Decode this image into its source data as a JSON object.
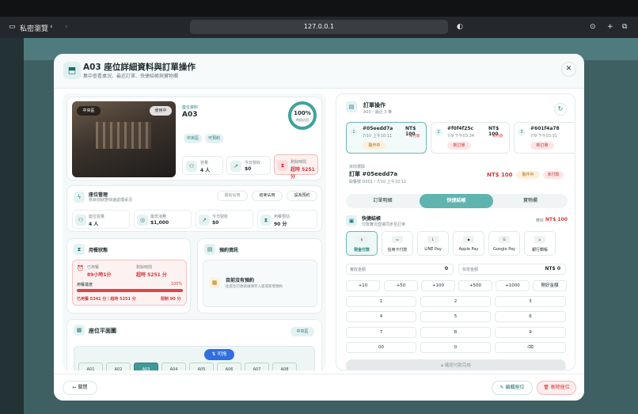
{
  "browser": {
    "private": "私密瀏覽",
    "url": "127.0.0.1"
  },
  "modal": {
    "title": "A03 座位詳細資料與訂單操作",
    "subtitle": "集中查看桌況、最近訂單、快捷結帳與寶物欄",
    "close": "✕",
    "seat_card": {
      "photo_zone": "中央區",
      "photo_status": "使用中",
      "label": "座位資料",
      "name": "A03",
      "ring_pct": "100%",
      "ring_label": "時段佔用",
      "ring_value": 1.0,
      "tags": [
        "中央區",
        "可預約"
      ],
      "stats": [
        {
          "label": "容量",
          "value": "4 人"
        },
        {
          "label": "今日營收",
          "value": "$0"
        },
        {
          "label": "剩餘時間",
          "value": "超時 5251 分"
        }
      ]
    },
    "management": {
      "title": "座位管理",
      "sub": "依目前狀態快速處理桌況",
      "btns": [
        "開始佔用",
        "結束佔用",
        "設為預約"
      ],
      "stats": [
        {
          "label": "座位容量",
          "value": "4 人"
        },
        {
          "label": "最低消費",
          "value": "$1,000"
        },
        {
          "label": "今日營收",
          "value": "$0"
        },
        {
          "label": "用餐預估",
          "value": "90 分"
        }
      ]
    },
    "usage": {
      "title": "用餐狀態",
      "used_label": "已用餐",
      "used_value": "89小時1分",
      "remain_label": "剩餘時間",
      "remain_value": "超時 5251 分",
      "progress_label": "用餐進度",
      "progress_pct": "100%",
      "progress_value": 1.0,
      "footer_left": "已用餐 5341 分｜超時 5251 分",
      "footer_right": "限制 90 分"
    },
    "reservation": {
      "title": "預約資訊",
      "empty_title": "目前沒有預約",
      "empty_sub": "此座位可收就做保存入座或新增預約"
    },
    "floor": {
      "title": "座位平面圖",
      "zone": "中央區",
      "seats": [
        "A01",
        "A02",
        "A03",
        "A04",
        "A05",
        "A06",
        "A07",
        "A08"
      ],
      "pill": "可拖"
    },
    "orders": {
      "title": "訂單操作",
      "sub": "A03・最近 3 筆",
      "list": [
        {
          "no": "1",
          "id": "#05eedd7a",
          "time": "7/10 上午10:11",
          "amount": "NT$ 100",
          "pay": "未付款",
          "status": "製作中"
        },
        {
          "no": "2",
          "id": "#f0f4f25c",
          "time": "7/9 下午03:34",
          "amount": "NT$ 100",
          "pay": "未付款",
          "status": "新訂單"
        },
        {
          "no": "3",
          "id": "#601f4a78",
          "time": "7/9 下午03:31",
          "amount": "",
          "pay": "",
          "status": "新訂單"
        }
      ],
      "current": {
        "label": "目前選取",
        "id": "訂單 #05eedd7a",
        "meta": "取餐號 D001・7/10 上午10:11",
        "amount": "NT$ 100",
        "status": "製作中",
        "pay": "未付款"
      },
      "tabs": [
        "訂單明細",
        "快捷結帳",
        "寶物欄"
      ],
      "checkout": {
        "title": "快捷結帳",
        "sub": "付款實況直接同步至訂單",
        "due_label": "應收",
        "due": "NT$ 100",
        "methods": [
          "現金付款",
          "信用卡付款",
          "LINE Pay",
          "Apple Pay",
          "Google Pay",
          "銀行轉帳"
        ],
        "received_label": "實收金額",
        "received": "0",
        "change_label": "找零金額",
        "change": "NT$ 0",
        "quick": [
          "+10",
          "+50",
          "+100",
          "+500",
          "+1000",
          "剛好金額"
        ],
        "keys": [
          "1",
          "2",
          "3",
          "4",
          "5",
          "6",
          "7",
          "8",
          "9",
          "00",
          "0",
          "⌫"
        ],
        "confirm": "確認付款完成"
      }
    },
    "footer": {
      "close": "關閉",
      "edit": "編輯座位",
      "delete": "刪除座位"
    }
  }
}
